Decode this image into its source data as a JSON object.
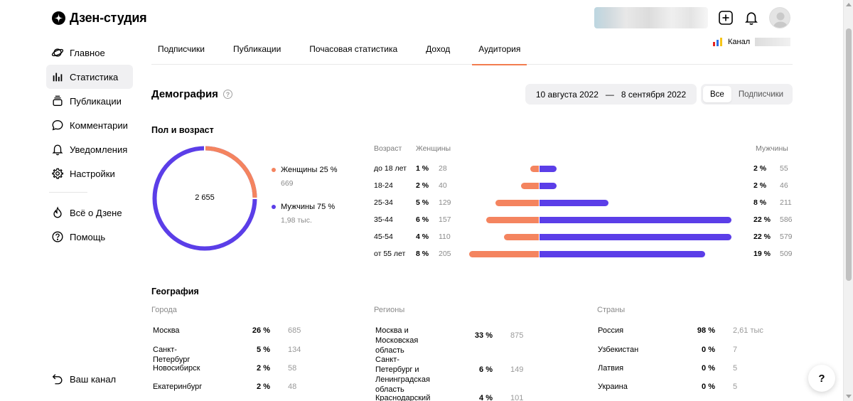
{
  "app": {
    "logo_text": "Дзен-студия"
  },
  "colors": {
    "accent": "#f27c4f",
    "female": "#f4845f",
    "male": "#5b3ee8",
    "sidebar_active": "#f0f0f2"
  },
  "sidebar": {
    "items": [
      {
        "label": "Главное",
        "icon": "planet-icon"
      },
      {
        "label": "Статистика",
        "icon": "bar-chart-icon",
        "active": true
      },
      {
        "label": "Публикации",
        "icon": "stack-icon"
      },
      {
        "label": "Комментарии",
        "icon": "comment-icon"
      },
      {
        "label": "Уведомления",
        "icon": "bell-icon"
      },
      {
        "label": "Настройки",
        "icon": "gear-icon"
      }
    ],
    "secondary": [
      {
        "label": "Всё о Дзене",
        "icon": "flame-icon"
      },
      {
        "label": "Помощь",
        "icon": "question-icon"
      }
    ],
    "your_channel": "Ваш канал"
  },
  "header": {
    "channel_label": "Канал"
  },
  "tabs": [
    {
      "label": "Подписчики"
    },
    {
      "label": "Публикации"
    },
    {
      "label": "Почасовая статистика"
    },
    {
      "label": "Доход"
    },
    {
      "label": "Аудитория",
      "active": true
    }
  ],
  "demography": {
    "title": "Демография",
    "help": "?",
    "date_from": "10 августа 2022",
    "date_dash": "—",
    "date_to": "8 сентября 2022",
    "filter_all": "Все",
    "filter_subscribers": "Подписчики",
    "gender_age_title": "Пол и возраст",
    "total": "2 655",
    "female_label": "Женщины 25 %",
    "female_count": "669",
    "female_share": 25,
    "male_label": "Мужчины 75 %",
    "male_count": "1,98 тыс.",
    "male_share": 75,
    "age_header": "Возраст",
    "women_header": "Женщины",
    "men_header": "Мужчины",
    "age_rows": [
      {
        "age": "до 18 лет",
        "w_pct": "1 %",
        "w_cnt": "28",
        "m_pct": "2 %",
        "m_cnt": "55"
      },
      {
        "age": "18-24",
        "w_pct": "2 %",
        "w_cnt": "40",
        "m_pct": "2 %",
        "m_cnt": "46"
      },
      {
        "age": "25-34",
        "w_pct": "5 %",
        "w_cnt": "129",
        "m_pct": "8 %",
        "m_cnt": "211"
      },
      {
        "age": "35-44",
        "w_pct": "6 %",
        "w_cnt": "157",
        "m_pct": "22 %",
        "m_cnt": "586"
      },
      {
        "age": "45-54",
        "w_pct": "4 %",
        "w_cnt": "110",
        "m_pct": "22 %",
        "m_cnt": "579"
      },
      {
        "age": "от 55 лет",
        "w_pct": "8 %",
        "w_cnt": "205",
        "m_pct": "19 %",
        "m_cnt": "509"
      }
    ]
  },
  "geography": {
    "title": "География",
    "cities_title": "Города",
    "regions_title": "Регионы",
    "countries_title": "Страны",
    "cities": [
      {
        "name": "Москва",
        "pct": "26 %",
        "cnt": "685"
      },
      {
        "name": "Санкт-Петербург",
        "pct": "5 %",
        "cnt": "134"
      },
      {
        "name": "Новосибирск",
        "pct": "2 %",
        "cnt": "58"
      },
      {
        "name": "Екатеринбург",
        "pct": "2 %",
        "cnt": "48"
      }
    ],
    "regions": [
      {
        "name1": "Москва и Московская",
        "name2": "область",
        "pct": "33 %",
        "cnt": "875"
      },
      {
        "name1": "Санкт-Петербург и",
        "name2": "Ленинградская",
        "name3": "область",
        "pct": "6 %",
        "cnt": "149"
      },
      {
        "name1": "Краснодарский край",
        "pct": "4 %",
        "cnt": "101"
      }
    ],
    "countries": [
      {
        "name": "Россия",
        "pct": "98 %",
        "cnt": "2,61 тыс"
      },
      {
        "name": "Узбекистан",
        "pct": "0 %",
        "cnt": "7"
      },
      {
        "name": "Латвия",
        "pct": "0 %",
        "cnt": "5"
      },
      {
        "name": "Украина",
        "pct": "0 %",
        "cnt": "5"
      }
    ]
  },
  "help_fab": "?"
}
